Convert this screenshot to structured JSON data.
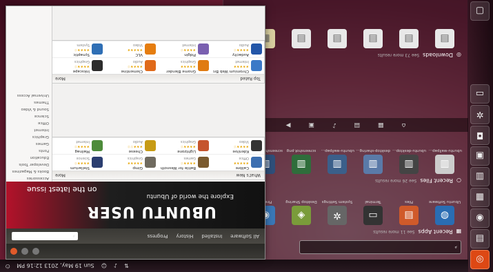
{
  "launcher": {
    "items": [
      "bfb",
      "home-folder",
      "firefox",
      "files",
      "software",
      "terminal",
      "settings",
      "apps",
      "docs",
      "music",
      "trash"
    ]
  },
  "toppanel": {
    "clock": "Sun 19 May, 2013  12:16 PM",
    "indicators": [
      "net",
      "vol",
      "user",
      "power"
    ]
  },
  "dash": {
    "search_placeholder": "",
    "recent_apps": {
      "title": "Recent Apps",
      "more": "See 11 more results",
      "items": [
        "Ubuntu Software",
        "Files",
        "Terminal",
        "System Settings",
        "Desktop Sharing",
        "Firefox"
      ]
    },
    "recent_files": {
      "title": "Recent Files",
      "more": "See 26 more results",
      "items": [
        "ubuntu-wallpaper.png",
        "ubuntu-desktop.png",
        "desktop-sharing.png",
        "ubuntu-wallpaper.png",
        "screenshot.png",
        "screenshot-dash.png"
      ]
    },
    "downloads": {
      "title": "Downloads",
      "more": "See 73 more results",
      "items": [
        "",
        "",
        "",
        "",
        "",
        ""
      ]
    },
    "filebar_icons": [
      "home",
      "apps",
      "files",
      "music",
      "photos",
      "video"
    ]
  },
  "software_center": {
    "search_placeholder": "",
    "toolbar_labels": [
      "All Software",
      "Installed",
      "History",
      "Progress"
    ],
    "banner": {
      "title": "UBUNTU USER",
      "tagline": "Explore the world of Ubuntu",
      "cta": "on the latest issue"
    },
    "whats_new": {
      "title": "What's New",
      "more": "More",
      "apps": [
        {
          "name": "Calibre",
          "stars": "★★★★★",
          "cat": "Office",
          "color": "#3d6fb0"
        },
        {
          "name": "Battle for Wesnoth",
          "stars": "★★★★☆",
          "cat": "Games",
          "color": "#7a5a2f"
        },
        {
          "name": "Gimp",
          "stars": "★★★★★",
          "cat": "Graphics",
          "color": "#6f6a5f"
        },
        {
          "name": "Stellarium",
          "stars": "★★★★☆",
          "cat": "Science",
          "color": "#2b3e70"
        },
        {
          "name": "Kdenlive",
          "stars": "★★★★☆",
          "cat": "Video",
          "color": "#333333"
        },
        {
          "name": "Lightzone",
          "stars": "★★★★☆",
          "cat": "Graphics",
          "color": "#c5552e"
        },
        {
          "name": "Cheese",
          "stars": "★★★☆☆",
          "cat": "Audio",
          "color": "#c79b14"
        },
        {
          "name": "Mailnag",
          "stars": "★★★★☆",
          "cat": "Internet",
          "color": "#4d8b3a"
        }
      ]
    },
    "top_rated": {
      "title": "Top Rated",
      "more": "More",
      "apps": [
        {
          "name": "Chromium Web Browser",
          "stars": "★★★★★",
          "cat": "Internet",
          "color": "#3b79c7"
        },
        {
          "name": "Gnome Blender",
          "stars": "★★★★★",
          "cat": "Graphics",
          "color": "#e07b12"
        },
        {
          "name": "Clementine",
          "stars": "★★★★☆",
          "cat": "Audio",
          "color": "#e06a1a"
        },
        {
          "name": "Inkscape",
          "stars": "★★★★☆",
          "cat": "Graphics",
          "color": "#2c2c2c"
        },
        {
          "name": "Audacity",
          "stars": "★★★★☆",
          "cat": "Audio",
          "color": "#2356a8"
        },
        {
          "name": "Pidgin",
          "stars": "★★★★☆",
          "cat": "Internet",
          "color": "#7a60b0"
        },
        {
          "name": "VLC",
          "stars": "★★★★★",
          "cat": "Video",
          "color": "#e57d10"
        },
        {
          "name": "Synaptic",
          "stars": "★★★★☆",
          "cat": "System",
          "color": "#2f6fb5"
        }
      ]
    },
    "sidebar": [
      "Accessories",
      "Books & Magazines",
      "Developer Tools",
      "Education",
      "Fonts",
      "Games",
      "Graphics",
      "Internet",
      "Office",
      "Science",
      "Sound & Video",
      "Themes",
      "Universal Access"
    ]
  },
  "colors": {
    "accent": "#dd4814",
    "panel": "#2a1a22"
  }
}
